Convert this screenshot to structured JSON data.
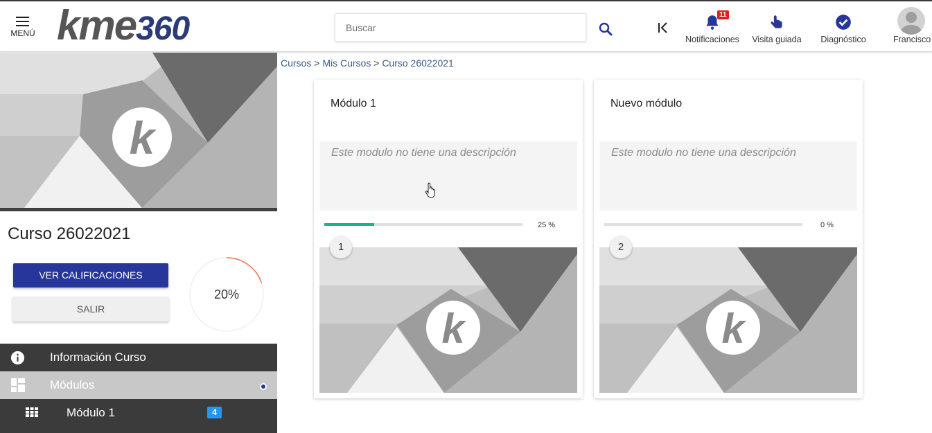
{
  "header": {
    "menu_label": "MENÚ",
    "logo_kme": "kme",
    "logo_num": "360",
    "search_placeholder": "Buscar",
    "notifications_label": "Notificaciones",
    "notifications_count": "11",
    "tour_label": "Visita guiada",
    "diagnostic_label": "Diagnóstico",
    "user_name": "Francisco"
  },
  "breadcrumb": {
    "items": [
      "Cursos",
      "Mis Cursos",
      "Curso 26022021"
    ],
    "separator": ">"
  },
  "course": {
    "title": "Curso 26022021",
    "grades_button": "VER CALIFICACIONES",
    "exit_button": "SALIR",
    "progress_label": "20%",
    "progress": 0.2
  },
  "sidebar": {
    "items": [
      {
        "label": "Información Curso",
        "icon": "info-icon"
      },
      {
        "label": "Módulos",
        "icon": "modules-icon"
      },
      {
        "label": "Módulo 1",
        "icon": "grid-icon",
        "count": "4"
      }
    ]
  },
  "modules": [
    {
      "title": "Módulo 1",
      "description": "Este modulo no tiene una descripción",
      "progress_label": "25 %",
      "progress": 0.25,
      "number": "1"
    },
    {
      "title": "Nuevo módulo",
      "description": "Este modulo no tiene una descripción",
      "progress_label": "0 %",
      "progress": 0,
      "number": "2"
    }
  ],
  "colors": {
    "accent": "#27369a",
    "progress": "#18b48a",
    "badge": "#e11f1f",
    "count_badge": "#2196f3",
    "ring": "#e07a48"
  }
}
